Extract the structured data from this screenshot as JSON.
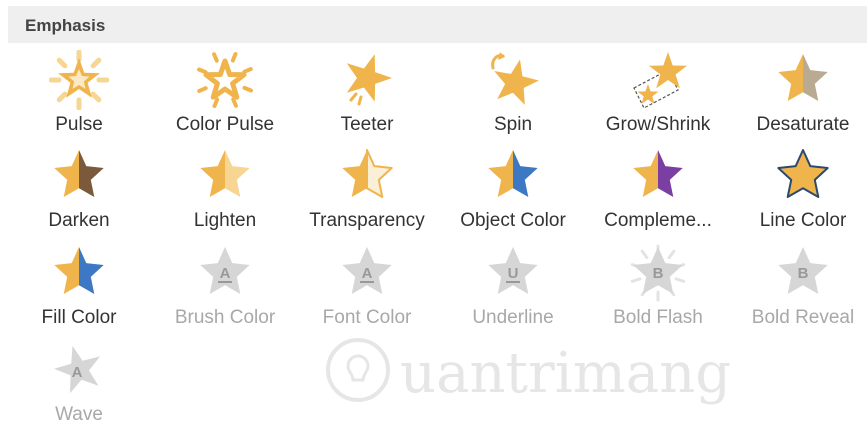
{
  "panel": {
    "title": "Emphasis"
  },
  "effects": [
    {
      "label": "Pulse",
      "icon": "pulse-icon",
      "enabled": true
    },
    {
      "label": "Color Pulse",
      "icon": "color-pulse-icon",
      "enabled": true
    },
    {
      "label": "Teeter",
      "icon": "teeter-icon",
      "enabled": true
    },
    {
      "label": "Spin",
      "icon": "spin-icon",
      "enabled": true
    },
    {
      "label": "Grow/Shrink",
      "icon": "grow-shrink-icon",
      "enabled": true
    },
    {
      "label": "Desaturate",
      "icon": "desaturate-icon",
      "enabled": true
    },
    {
      "label": "Darken",
      "icon": "darken-icon",
      "enabled": true
    },
    {
      "label": "Lighten",
      "icon": "lighten-icon",
      "enabled": true
    },
    {
      "label": "Transparency",
      "icon": "transparency-icon",
      "enabled": true
    },
    {
      "label": "Object Color",
      "icon": "object-color-icon",
      "enabled": true
    },
    {
      "label": "Compleme...",
      "icon": "complementary-color-icon",
      "enabled": true
    },
    {
      "label": "Line Color",
      "icon": "line-color-icon",
      "enabled": true
    },
    {
      "label": "Fill Color",
      "icon": "fill-color-icon",
      "enabled": true
    },
    {
      "label": "Brush Color",
      "icon": "brush-color-icon",
      "enabled": false,
      "glyph": "A"
    },
    {
      "label": "Font Color",
      "icon": "font-color-icon",
      "enabled": false,
      "glyph": "A"
    },
    {
      "label": "Underline",
      "icon": "underline-icon",
      "enabled": false,
      "glyph": "U"
    },
    {
      "label": "Bold Flash",
      "icon": "bold-flash-icon",
      "enabled": false,
      "glyph": "B"
    },
    {
      "label": "Bold Reveal",
      "icon": "bold-reveal-icon",
      "enabled": false,
      "glyph": "B"
    },
    {
      "label": "Wave",
      "icon": "wave-icon",
      "enabled": false,
      "glyph": "A"
    }
  ],
  "colors": {
    "gold": "#f0b44c",
    "gold_light": "#f7d592",
    "brown": "#7a5a3a",
    "taupe": "#b9ab92",
    "blue": "#3d78c4",
    "purple": "#7a3fa0",
    "gray_star": "#d6d6d6",
    "disabled_text": "#a8a8a8"
  },
  "watermark": {
    "brand": "uantrimang"
  }
}
